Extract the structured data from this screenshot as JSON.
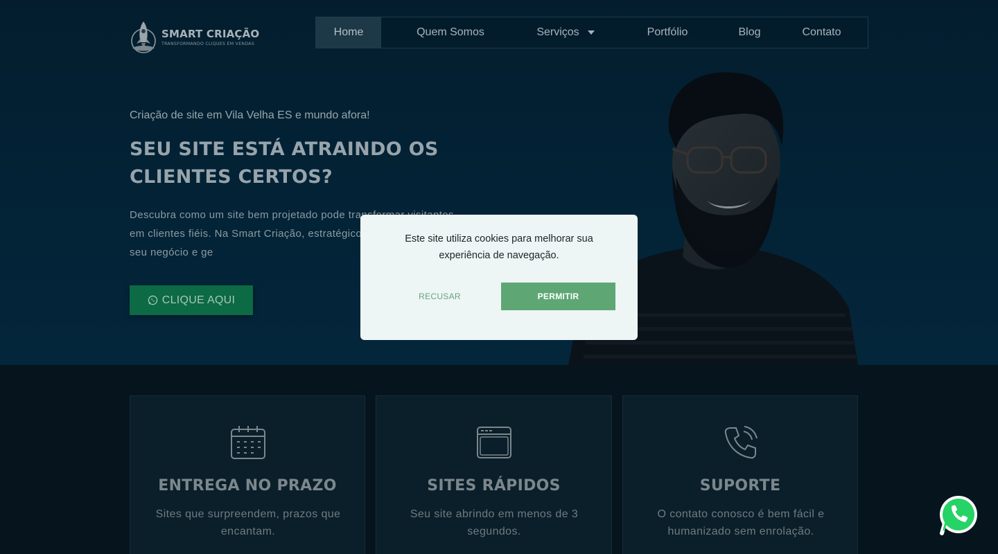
{
  "logo": {
    "title": "SMART CRIAÇÃO",
    "subtitle": "TRANSFORMANDO CLIQUES EM VENDAS",
    "icon": "rocket-icon"
  },
  "nav": {
    "items": [
      {
        "label": "Home",
        "active": true
      },
      {
        "label": "Quem Somos"
      },
      {
        "label": "Serviços",
        "has_dropdown": true
      },
      {
        "label": "Portfólio"
      },
      {
        "label": "Blog"
      },
      {
        "label": "Contato"
      }
    ]
  },
  "hero": {
    "kicker": "Criação de site em Vila Velha ES e mundo afora!",
    "title": "SEU SITE ESTÁ ATRAINDO OS CLIENTES CERTOS?",
    "description": "Descubra como um site bem projetado pode transformar visitantes em clientes fiéis. Na Smart Criação, estratégicos para destacar seu negócio e ge",
    "cta_label": "CLIQUE AQUI",
    "cta_icon": "whatsapp-icon"
  },
  "cookie": {
    "message": "Este site utiliza cookies para melhorar sua experiência de navegação.",
    "refuse_label": "RECUSAR",
    "allow_label": "PERMITIR"
  },
  "features": [
    {
      "icon": "calendar-icon",
      "title": "ENTREGA NO PRAZO",
      "description": "Sites que surpreendem, prazos que encantam."
    },
    {
      "icon": "browser-window-icon",
      "title": "SITES RÁPIDOS",
      "description": "Seu site abrindo em menos de 3 segundos."
    },
    {
      "icon": "phone-icon",
      "title": "SUPORTE",
      "description": "O contato conosco é bem fácil e humanizado sem enrolação."
    }
  ],
  "colors": {
    "accent": "#5ea775",
    "cta": "#0c6a44",
    "hero_bg": "#06324a",
    "whatsapp": "#25d366"
  },
  "floating_button": {
    "icon": "whatsapp-icon"
  }
}
